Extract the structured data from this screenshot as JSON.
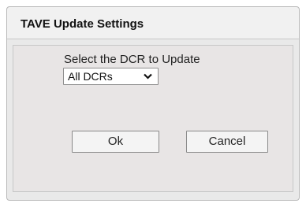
{
  "dialog": {
    "title": "TAVE Update Settings",
    "select_label": "Select the DCR to Update",
    "dcr_select": {
      "selected": "All DCRs",
      "icon": "chevron-down-icon"
    },
    "ok_label": "Ok",
    "cancel_label": "Cancel"
  }
}
